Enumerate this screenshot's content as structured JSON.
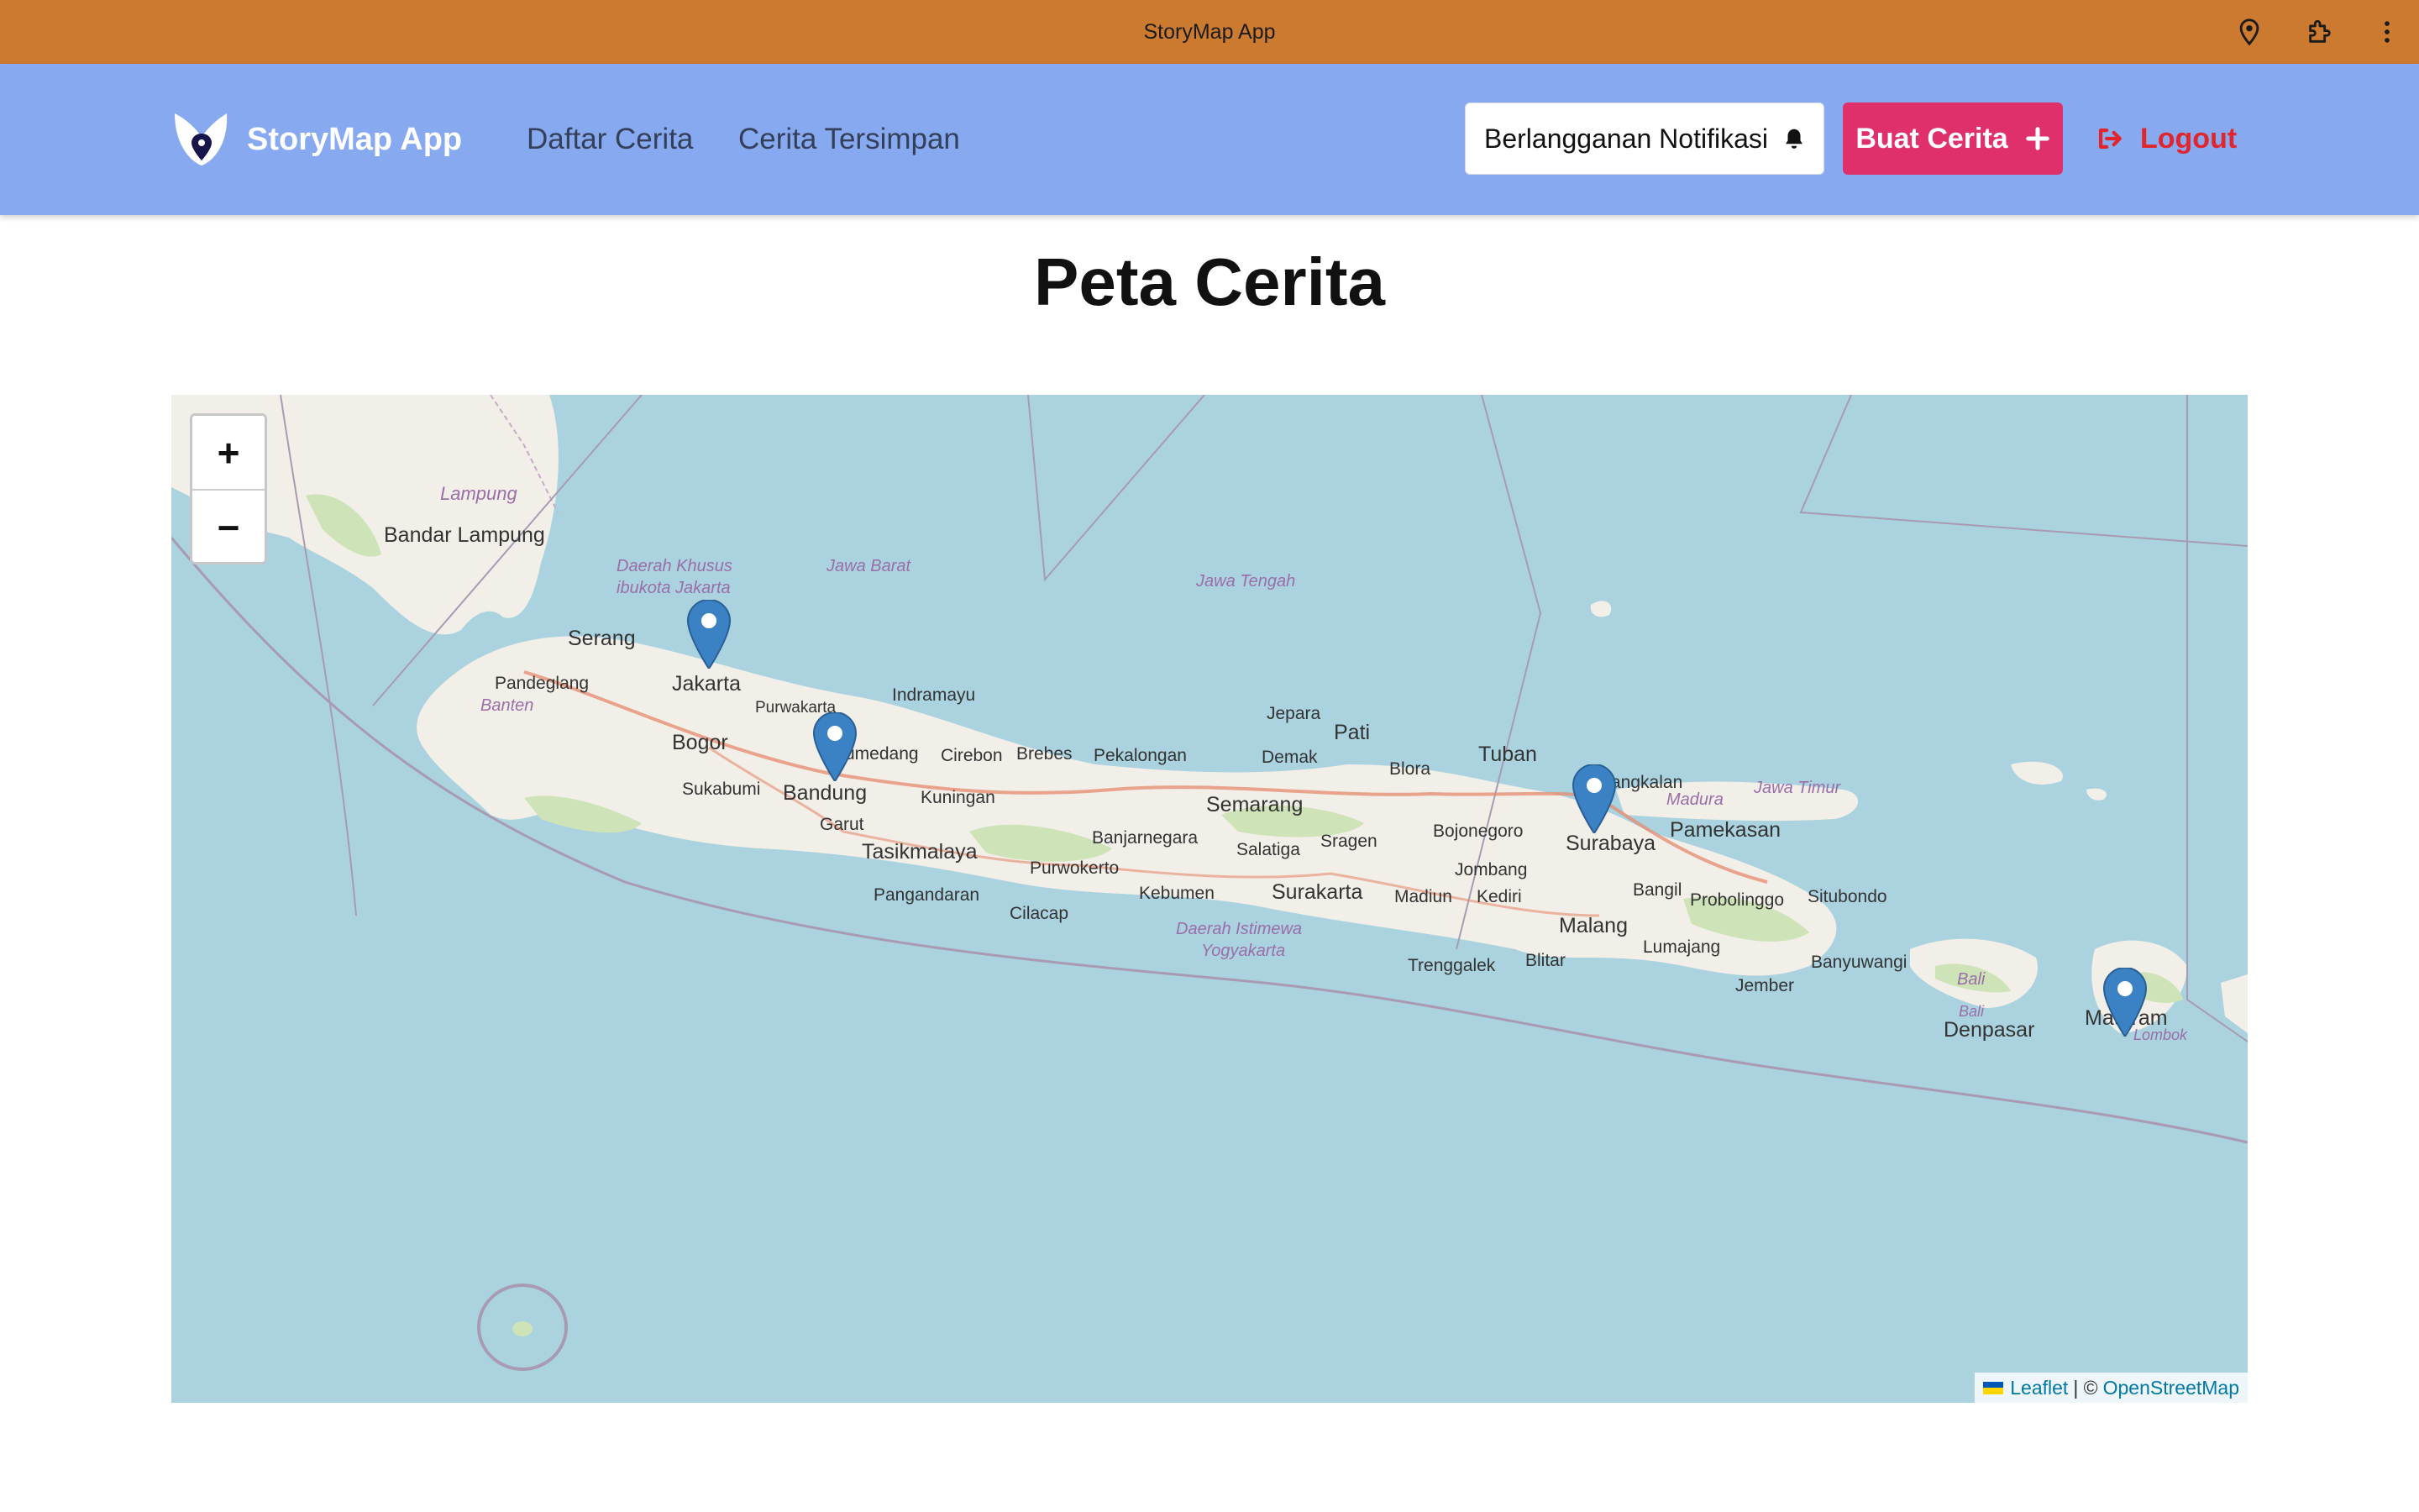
{
  "window": {
    "title": "StoryMap App"
  },
  "nav": {
    "brand": "StoryMap App",
    "links": [
      "Daftar Cerita",
      "Cerita Tersimpan"
    ],
    "subscribe_label": "Berlangganan Notifikasi",
    "create_label": "Buat Cerita",
    "logout_label": "Logout"
  },
  "page": {
    "title": "Peta Cerita"
  },
  "map": {
    "zoom_in": "+",
    "zoom_out": "−",
    "attribution": {
      "leaflet": "Leaflet",
      "separator": "| ©",
      "osm": "OpenStreetMap"
    },
    "markers": [
      {
        "place": "Jakarta"
      },
      {
        "place": "Bandung"
      },
      {
        "place": "Surabaya"
      },
      {
        "place": "Mataram"
      }
    ],
    "place_labels": {
      "lampung": "Lampung",
      "bandar_lampung": "Bandar Lampung",
      "dki": "Daerah Khusus",
      "dki2": "ibukota Jakarta",
      "jawa_barat": "Jawa Barat",
      "jawa_tengah": "Jawa Tengah",
      "serang": "Serang",
      "pandeglang": "Pandeglang",
      "banten": "Banten",
      "jakarta": "Jakarta",
      "bogor": "Bogor",
      "purwakarta": "Purwakarta",
      "indramayu": "Indramayu",
      "sumedang": "Sumedang",
      "sukabumi": "Sukabumi",
      "bandung": "Bandung",
      "cirebon": "Cirebon",
      "brebes": "Brebes",
      "pekalongan": "Pekalongan",
      "kuningan": "Kuningan",
      "garut": "Garut",
      "tasikmalaya": "Tasikmalaya",
      "pangandaran": "Pangandaran",
      "cilacap": "Cilacap",
      "purwokerto": "Purwokerto",
      "banjarnegara": "Banjarnegara",
      "kebumen": "Kebumen",
      "semarang": "Semarang",
      "salatiga": "Salatiga",
      "jepara": "Jepara",
      "demak": "Demak",
      "pati": "Pati",
      "blora": "Blora",
      "tuban": "Tuban",
      "bojonegoro": "Bojonegoro",
      "sragen": "Sragen",
      "surakarta": "Surakarta",
      "madiun": "Madiun",
      "kediri": "Kediri",
      "diy": "Daerah Istimewa",
      "diy2": "Yogyakarta",
      "jombang": "Jombang",
      "trenggalek": "Trenggalek",
      "blitar": "Blitar",
      "malang": "Malang",
      "surabaya": "Surabaya",
      "bangkalan": "Bangkalan",
      "madura": "Madura",
      "pamekasan": "Pamekasan",
      "jawa_timur": "Jawa Timur",
      "bangil": "Bangil",
      "probolinggo": "Probolinggo",
      "situbondo": "Situbondo",
      "lumajang": "Lumajang",
      "jember": "Jember",
      "banyuwangi": "Banyuwangi",
      "bali": "Bali",
      "bali2": "Bali",
      "denpasar": "Denpasar",
      "mataram": "Mataram",
      "lombok": "Lombok"
    }
  },
  "colors": {
    "titlebar": "#cd7a31",
    "nav": "#87a9f0",
    "accent": "#e0306b",
    "logout": "#e0252c",
    "sea": "#aad3df",
    "land": "#f2efe9",
    "marker": "#3b82c4"
  },
  "icons": [
    "location-icon",
    "extensions-icon",
    "more-vert-icon",
    "bell-icon",
    "plus-icon",
    "logout-icon"
  ]
}
